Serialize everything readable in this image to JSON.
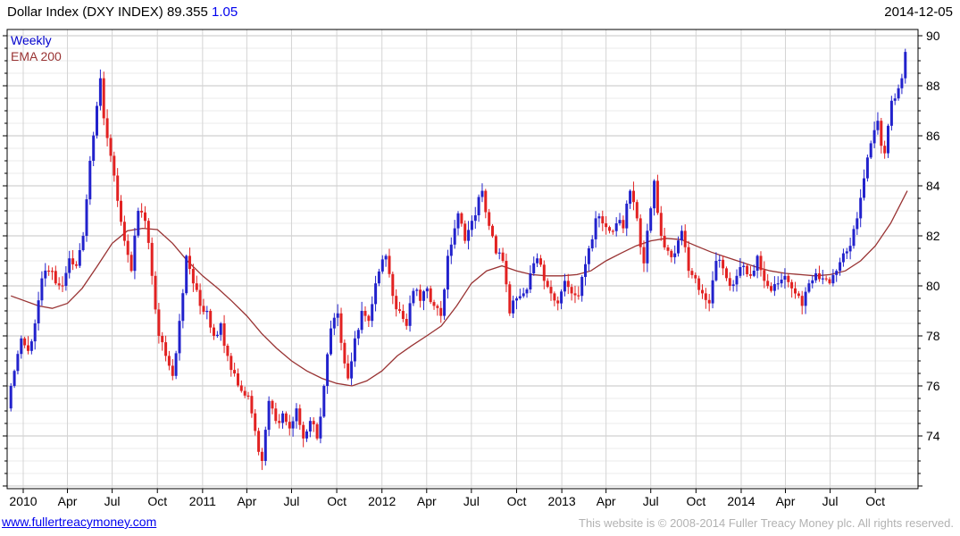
{
  "header": {
    "title_main": "Dollar Index (DXY INDEX) 89.355",
    "title_change": "1.05",
    "date": "2014-12-05"
  },
  "legend": {
    "timeframe": "Weekly",
    "overlay": "EMA 200"
  },
  "footer": {
    "link": "www.fullertreacymoney.com",
    "copyright": "This website is © 2008-2014 Fuller Treacy Money plc. All rights reserved."
  },
  "colors": {
    "up_candle": "#2222cc",
    "down_candle": "#e22222",
    "ema_line": "#993333",
    "grid_minor": "#ebebeb",
    "grid_major": "#c6c6c6",
    "grid_vertical": "#d4d4d4",
    "border": "#000000",
    "link_blue": "#0000ee",
    "copy_gray": "#b2b2b2"
  },
  "chart_data": {
    "type": "candlestick",
    "title": "Dollar Index (DXY INDEX)",
    "timeframe": "weekly",
    "last_price": 89.355,
    "change": 1.05,
    "as_of": "2014-12-05",
    "overlay": "EMA 200",
    "ylim": [
      71.9,
      90.25
    ],
    "grid": "minor 0.5 / major 2.0, vertical quarterly",
    "legend_position": "top-left",
    "y_ticks": [
      74,
      76,
      78,
      80,
      82,
      84,
      86,
      88,
      90
    ],
    "x_ticks": [
      [
        "2010-01-01",
        "2010"
      ],
      [
        "2010-04-01",
        "Apr"
      ],
      [
        "2010-07-01",
        "Jul"
      ],
      [
        "2010-10-01",
        "Oct"
      ],
      [
        "2011-01-01",
        "2011"
      ],
      [
        "2011-04-01",
        "Apr"
      ],
      [
        "2011-07-01",
        "Jul"
      ],
      [
        "2011-10-01",
        "Oct"
      ],
      [
        "2012-01-01",
        "2012"
      ],
      [
        "2012-04-01",
        "Apr"
      ],
      [
        "2012-07-01",
        "Jul"
      ],
      [
        "2012-10-01",
        "Oct"
      ],
      [
        "2013-01-01",
        "2013"
      ],
      [
        "2013-04-01",
        "Apr"
      ],
      [
        "2013-07-01",
        "Jul"
      ],
      [
        "2013-10-01",
        "Oct"
      ],
      [
        "2014-01-01",
        "2014"
      ],
      [
        "2014-04-01",
        "Apr"
      ],
      [
        "2014-07-01",
        "Jul"
      ],
      [
        "2014-10-01",
        "Oct"
      ]
    ],
    "close_anchors": [
      [
        "2009-12-07",
        76.0
      ],
      [
        "2009-12-14",
        76.6
      ],
      [
        "2009-12-28",
        77.9
      ],
      [
        "2010-01-11",
        77.4
      ],
      [
        "2010-01-25",
        78.5
      ],
      [
        "2010-02-08",
        80.3
      ],
      [
        "2010-02-22",
        80.6
      ],
      [
        "2010-03-08",
        80.1
      ],
      [
        "2010-03-22",
        80.0
      ],
      [
        "2010-04-05",
        81.1
      ],
      [
        "2010-04-19",
        80.8
      ],
      [
        "2010-05-03",
        82.0
      ],
      [
        "2010-05-17",
        85.0
      ],
      [
        "2010-06-07",
        88.3
      ],
      [
        "2010-06-14",
        86.7
      ],
      [
        "2010-06-28",
        85.2
      ],
      [
        "2010-07-12",
        83.4
      ],
      [
        "2010-07-26",
        81.8
      ],
      [
        "2010-08-09",
        80.6
      ],
      [
        "2010-08-23",
        83.0
      ],
      [
        "2010-09-06",
        82.6
      ],
      [
        "2010-09-20",
        80.4
      ],
      [
        "2010-10-04",
        78.0
      ],
      [
        "2010-10-18",
        77.2
      ],
      [
        "2010-11-01",
        76.4
      ],
      [
        "2010-11-15",
        78.6
      ],
      [
        "2010-11-29",
        81.2
      ],
      [
        "2010-12-13",
        80.1
      ],
      [
        "2010-12-27",
        79.2
      ],
      [
        "2011-01-10",
        79.0
      ],
      [
        "2011-01-24",
        78.0
      ],
      [
        "2011-02-07",
        78.5
      ],
      [
        "2011-02-21",
        77.2
      ],
      [
        "2011-03-07",
        76.5
      ],
      [
        "2011-03-21",
        75.8
      ],
      [
        "2011-04-04",
        75.6
      ],
      [
        "2011-04-18",
        74.2
      ],
      [
        "2011-05-02",
        73.0
      ],
      [
        "2011-05-16",
        75.4
      ],
      [
        "2011-05-30",
        74.6
      ],
      [
        "2011-06-13",
        74.9
      ],
      [
        "2011-06-27",
        74.3
      ],
      [
        "2011-07-11",
        75.1
      ],
      [
        "2011-07-25",
        73.9
      ],
      [
        "2011-08-08",
        74.6
      ],
      [
        "2011-08-22",
        73.9
      ],
      [
        "2011-09-05",
        76.0
      ],
      [
        "2011-09-19",
        78.3
      ],
      [
        "2011-10-03",
        78.9
      ],
      [
        "2011-10-17",
        76.9
      ],
      [
        "2011-10-24",
        76.3
      ],
      [
        "2011-11-07",
        77.9
      ],
      [
        "2011-11-21",
        79.0
      ],
      [
        "2011-12-05",
        78.6
      ],
      [
        "2011-12-19",
        80.1
      ],
      [
        "2012-01-09",
        81.2
      ],
      [
        "2012-01-23",
        79.6
      ],
      [
        "2012-02-06",
        79.0
      ],
      [
        "2012-02-20",
        78.4
      ],
      [
        "2012-03-05",
        79.8
      ],
      [
        "2012-03-19",
        79.4
      ],
      [
        "2012-04-02",
        79.9
      ],
      [
        "2012-04-16",
        79.2
      ],
      [
        "2012-04-30",
        78.8
      ],
      [
        "2012-05-14",
        81.2
      ],
      [
        "2012-06-04",
        82.9
      ],
      [
        "2012-06-18",
        81.8
      ],
      [
        "2012-07-02",
        82.6
      ],
      [
        "2012-07-23",
        83.8
      ],
      [
        "2012-08-06",
        82.4
      ],
      [
        "2012-08-20",
        81.3
      ],
      [
        "2012-09-03",
        81.0
      ],
      [
        "2012-09-17",
        78.9
      ],
      [
        "2012-10-01",
        79.5
      ],
      [
        "2012-10-15",
        79.7
      ],
      [
        "2012-10-29",
        80.5
      ],
      [
        "2012-11-12",
        81.1
      ],
      [
        "2012-11-26",
        80.2
      ],
      [
        "2012-12-10",
        79.7
      ],
      [
        "2012-12-24",
        79.3
      ],
      [
        "2013-01-07",
        80.2
      ],
      [
        "2013-01-21",
        79.7
      ],
      [
        "2013-02-04",
        79.6
      ],
      [
        "2013-02-25",
        81.5
      ],
      [
        "2013-03-11",
        82.7
      ],
      [
        "2013-03-25",
        82.5
      ],
      [
        "2013-04-08",
        82.2
      ],
      [
        "2013-04-22",
        82.5
      ],
      [
        "2013-05-06",
        82.3
      ],
      [
        "2013-05-20",
        83.8
      ],
      [
        "2013-06-03",
        82.7
      ],
      [
        "2013-06-17",
        80.9
      ],
      [
        "2013-07-01",
        83.1
      ],
      [
        "2013-07-08",
        84.2
      ],
      [
        "2013-07-22",
        82.0
      ],
      [
        "2013-08-05",
        81.4
      ],
      [
        "2013-08-19",
        81.3
      ],
      [
        "2013-09-02",
        82.2
      ],
      [
        "2013-09-16",
        80.6
      ],
      [
        "2013-09-30",
        80.3
      ],
      [
        "2013-10-14",
        79.7
      ],
      [
        "2013-10-28",
        79.3
      ],
      [
        "2013-11-11",
        81.0
      ],
      [
        "2013-11-25",
        80.7
      ],
      [
        "2013-12-09",
        80.0
      ],
      [
        "2013-12-23",
        80.4
      ],
      [
        "2014-01-06",
        80.8
      ],
      [
        "2014-01-20",
        80.4
      ],
      [
        "2014-02-03",
        81.2
      ],
      [
        "2014-02-17",
        80.2
      ],
      [
        "2014-03-03",
        79.8
      ],
      [
        "2014-03-17",
        80.1
      ],
      [
        "2014-03-31",
        80.4
      ],
      [
        "2014-04-14",
        79.9
      ],
      [
        "2014-04-28",
        79.6
      ],
      [
        "2014-05-05",
        79.2
      ],
      [
        "2014-05-19",
        80.1
      ],
      [
        "2014-06-02",
        80.5
      ],
      [
        "2014-06-16",
        80.3
      ],
      [
        "2014-06-30",
        80.1
      ],
      [
        "2014-07-14",
        80.6
      ],
      [
        "2014-07-28",
        81.3
      ],
      [
        "2014-08-11",
        81.6
      ],
      [
        "2014-08-25",
        82.7
      ],
      [
        "2014-09-08",
        84.3
      ],
      [
        "2014-09-22",
        85.7
      ],
      [
        "2014-10-06",
        86.6
      ],
      [
        "2014-10-13",
        85.6
      ],
      [
        "2014-10-20",
        85.3
      ],
      [
        "2014-10-27",
        86.4
      ],
      [
        "2014-11-03",
        87.4
      ],
      [
        "2014-11-17",
        87.9
      ],
      [
        "2014-11-24",
        88.3
      ],
      [
        "2014-12-01",
        89.355
      ]
    ],
    "ema_anchors": [
      [
        "2009-12-07",
        79.6
      ],
      [
        "2010-02-01",
        79.2
      ],
      [
        "2010-03-01",
        79.1
      ],
      [
        "2010-04-01",
        79.3
      ],
      [
        "2010-05-01",
        79.9
      ],
      [
        "2010-06-01",
        80.8
      ],
      [
        "2010-07-01",
        81.7
      ],
      [
        "2010-08-01",
        82.2
      ],
      [
        "2010-09-01",
        82.3
      ],
      [
        "2010-10-01",
        82.25
      ],
      [
        "2010-11-01",
        81.7
      ],
      [
        "2010-12-01",
        81.0
      ],
      [
        "2011-01-01",
        80.4
      ],
      [
        "2011-02-01",
        79.9
      ],
      [
        "2011-03-01",
        79.4
      ],
      [
        "2011-04-01",
        78.8
      ],
      [
        "2011-05-01",
        78.1
      ],
      [
        "2011-06-01",
        77.5
      ],
      [
        "2011-07-01",
        77.0
      ],
      [
        "2011-08-01",
        76.6
      ],
      [
        "2011-09-01",
        76.3
      ],
      [
        "2011-10-01",
        76.1
      ],
      [
        "2011-11-01",
        76.0
      ],
      [
        "2011-12-01",
        76.2
      ],
      [
        "2012-01-01",
        76.6
      ],
      [
        "2012-02-01",
        77.2
      ],
      [
        "2012-03-01",
        77.6
      ],
      [
        "2012-04-01",
        78.0
      ],
      [
        "2012-05-01",
        78.4
      ],
      [
        "2012-06-01",
        79.2
      ],
      [
        "2012-07-01",
        80.1
      ],
      [
        "2012-08-01",
        80.6
      ],
      [
        "2012-09-01",
        80.8
      ],
      [
        "2012-10-01",
        80.6
      ],
      [
        "2012-11-01",
        80.45
      ],
      [
        "2012-12-01",
        80.4
      ],
      [
        "2013-01-01",
        80.4
      ],
      [
        "2013-02-01",
        80.45
      ],
      [
        "2013-03-01",
        80.6
      ],
      [
        "2013-04-01",
        81.0
      ],
      [
        "2013-05-01",
        81.3
      ],
      [
        "2013-06-01",
        81.6
      ],
      [
        "2013-07-01",
        81.8
      ],
      [
        "2013-08-01",
        81.9
      ],
      [
        "2013-09-01",
        81.85
      ],
      [
        "2013-10-01",
        81.6
      ],
      [
        "2013-11-01",
        81.35
      ],
      [
        "2013-12-01",
        81.15
      ],
      [
        "2014-01-01",
        80.95
      ],
      [
        "2014-02-01",
        80.75
      ],
      [
        "2014-03-01",
        80.6
      ],
      [
        "2014-04-01",
        80.5
      ],
      [
        "2014-05-01",
        80.45
      ],
      [
        "2014-06-01",
        80.4
      ],
      [
        "2014-07-01",
        80.45
      ],
      [
        "2014-08-01",
        80.6
      ],
      [
        "2014-09-01",
        81.0
      ],
      [
        "2014-10-01",
        81.6
      ],
      [
        "2014-11-01",
        82.5
      ],
      [
        "2014-12-05",
        83.8
      ]
    ]
  }
}
